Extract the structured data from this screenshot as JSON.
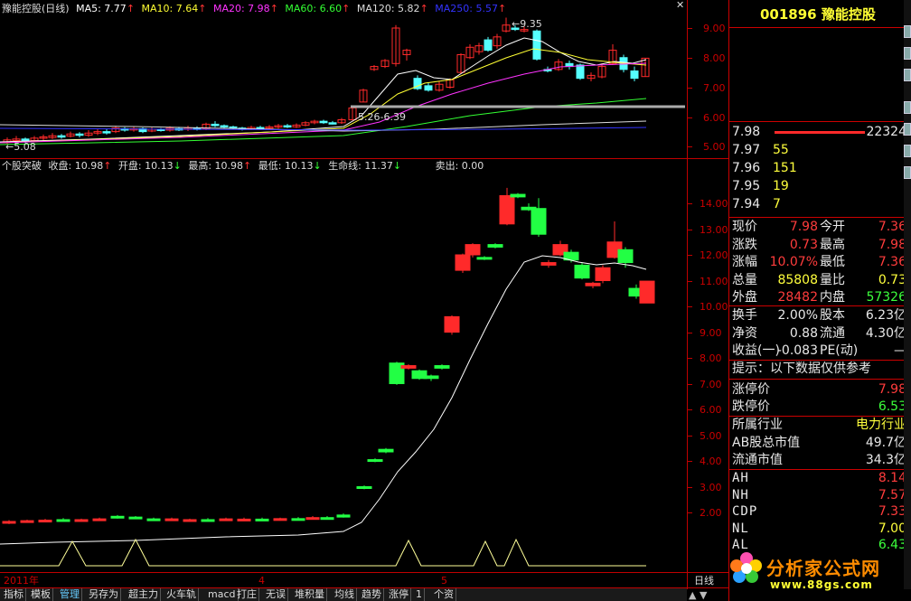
{
  "top_legend": {
    "name": "豫能控股(日线)",
    "ma5": "MA5: 7.77",
    "ma10": "MA10: 7.64",
    "ma20": "MA20: 7.98",
    "ma60": "MA60: 6.60",
    "ma120": "MA120: 5.82",
    "ma250": "MA250: 5.57"
  },
  "top_annotations": {
    "high": "9.35",
    "low": "5.08",
    "line": "5.26-6.39"
  },
  "top_yaxis": [
    "9.00",
    "8.00",
    "7.00",
    "6.00",
    "5.00"
  ],
  "bottom_legend": {
    "name": "个股突破",
    "close": "收盘: 10.98",
    "open": "开盘: 10.13",
    "high": "最高: 10.98",
    "low": "最低: 10.13",
    "life": "生命线: 11.37",
    "sell": "卖出: 0.00"
  },
  "bottom_yaxis": [
    "14.00",
    "13.00",
    "12.00",
    "11.00",
    "10.00",
    "9.00",
    "8.00",
    "7.00",
    "6.00",
    "5.00",
    "4.00",
    "3.00",
    "2.00"
  ],
  "xaxis": {
    "year": "2011年",
    "m4": "4",
    "m5": "5",
    "period": "日线"
  },
  "tabs": [
    "指标",
    "模板",
    "管理",
    "另存为",
    "超主力",
    "火车轨",
    "macd",
    "打庄",
    "无误",
    "堆积量",
    "均线",
    "趋势",
    "涨停",
    "1",
    "个资"
  ],
  "active_tab": "管理",
  "info": {
    "code": "001896",
    "name": "豫能控股",
    "orderbook": [
      {
        "price": "7.98",
        "vol": "22324"
      },
      {
        "price": "7.97",
        "vol": "55"
      },
      {
        "price": "7.96",
        "vol": "151"
      },
      {
        "price": "7.95",
        "vol": "19"
      },
      {
        "price": "7.94",
        "vol": "7"
      }
    ],
    "quote": [
      {
        "k": "现价",
        "v": "7.98",
        "k2": "今开",
        "v2": "7.36"
      },
      {
        "k": "涨跌",
        "v": "0.73",
        "k2": "最高",
        "v2": "7.98"
      },
      {
        "k": "涨幅",
        "v": "10.07%",
        "k2": "最低",
        "v2": "7.36"
      },
      {
        "k": "总量",
        "v": "85808",
        "k2": "量比",
        "v2": "0.73"
      },
      {
        "k": "外盘",
        "v": "28482",
        "k2": "内盘",
        "v2": "57326"
      }
    ],
    "stats": [
      {
        "k": "换手",
        "v": "2.00%",
        "k2": "股本",
        "v2": "6.23亿"
      },
      {
        "k": "净资",
        "v": "0.88",
        "k2": "流通",
        "v2": "4.30亿"
      },
      {
        "k": "收益(一)",
        "v": "-0.083",
        "k2": "PE(动)",
        "v2": "—"
      }
    ],
    "notice": "提示：以下数据仅供参考",
    "limit_up_label": "涨停价",
    "limit_up": "7.98",
    "limit_down_label": "跌停价",
    "limit_down": "6.53",
    "industry_label": "所属行业",
    "industry": "电力行业",
    "ab_cap_label": "AB股总市值",
    "ab_cap": "49.7亿",
    "float_cap_label": "流通市值",
    "float_cap": "34.3亿",
    "indices": [
      {
        "k": "AH",
        "v": "8.14",
        "c": "red"
      },
      {
        "k": "NH",
        "v": "7.57",
        "c": "red"
      },
      {
        "k": "CDP",
        "v": "7.33",
        "c": "red"
      },
      {
        "k": "NL",
        "v": "7.00",
        "c": "yel"
      },
      {
        "k": "AL",
        "v": "6.43",
        "c": "grn"
      }
    ]
  },
  "watermark": {
    "title": "分析家公式网",
    "url": "www.88gs.com"
  },
  "colors": {
    "up": "#ff2a2a",
    "down": "#22ff44",
    "down_top": "#5ff",
    "axis": "#c00000",
    "bg": "#000000"
  }
}
